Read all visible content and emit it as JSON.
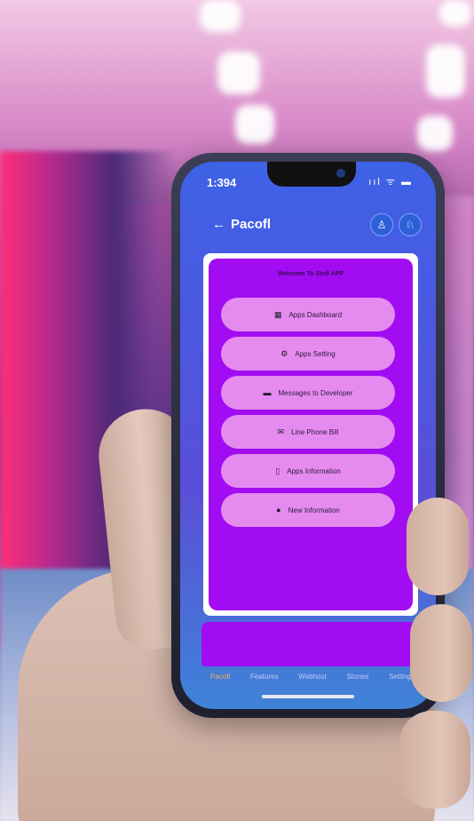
{
  "status_bar": {
    "time": "1:394",
    "icons": "ııl ᯤ ▬"
  },
  "header": {
    "back_icon": "arrow-left-icon",
    "title": "Pacofl",
    "action_icons": [
      "bell-icon",
      "profile-icon"
    ]
  },
  "card": {
    "title": "Welcome To Sirdi APP",
    "buttons": [
      {
        "icon": "dashboard-icon",
        "glyph": "▦",
        "label": "Apps Dashboard"
      },
      {
        "icon": "gear-icon",
        "glyph": "⚙",
        "label": "Apps Setting"
      },
      {
        "icon": "chat-icon",
        "glyph": "▬",
        "label": "Messages to Developer"
      },
      {
        "icon": "mail-icon",
        "glyph": "✉",
        "label": "Line Phone Bill"
      },
      {
        "icon": "phone-icon",
        "glyph": "▯",
        "label": "Apps Information"
      },
      {
        "icon": "person-icon",
        "glyph": "●",
        "label": "New Information"
      }
    ]
  },
  "tabs": [
    "Pacofl",
    "Features",
    "Webhost",
    "Stories",
    "Setting"
  ],
  "active_tab": 0,
  "colors": {
    "card_purple": "#a20cf2",
    "button_pink": "#e58bf0",
    "screen_blue": "#4b58e0",
    "active_tab": "#f2b25c"
  }
}
